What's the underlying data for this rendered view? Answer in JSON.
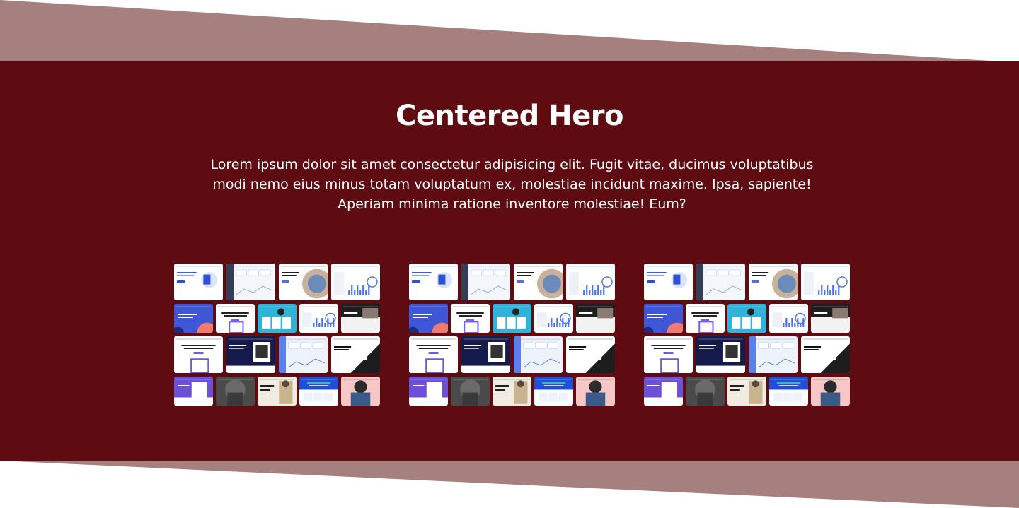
{
  "colors": {
    "hero_bg": "#5e0b12",
    "wedge": "#a67f7f",
    "heading": "#ffffff",
    "body_text": "#ffffff"
  },
  "hero": {
    "title": "Centered Hero",
    "description": "Lorem ipsum dolor sit amet consectetur adipisicing elit. Fugit vitae, ducimus voluptatibus modi nemo eius minus totam voluptatum ex, molestiae incidunt maxime. Ipsa, sapiente! Aperiam minima ratione inventore molestiae! Eum?"
  },
  "collages": [
    {
      "name": "template-collage"
    },
    {
      "name": "template-collage"
    },
    {
      "name": "template-collage"
    }
  ]
}
